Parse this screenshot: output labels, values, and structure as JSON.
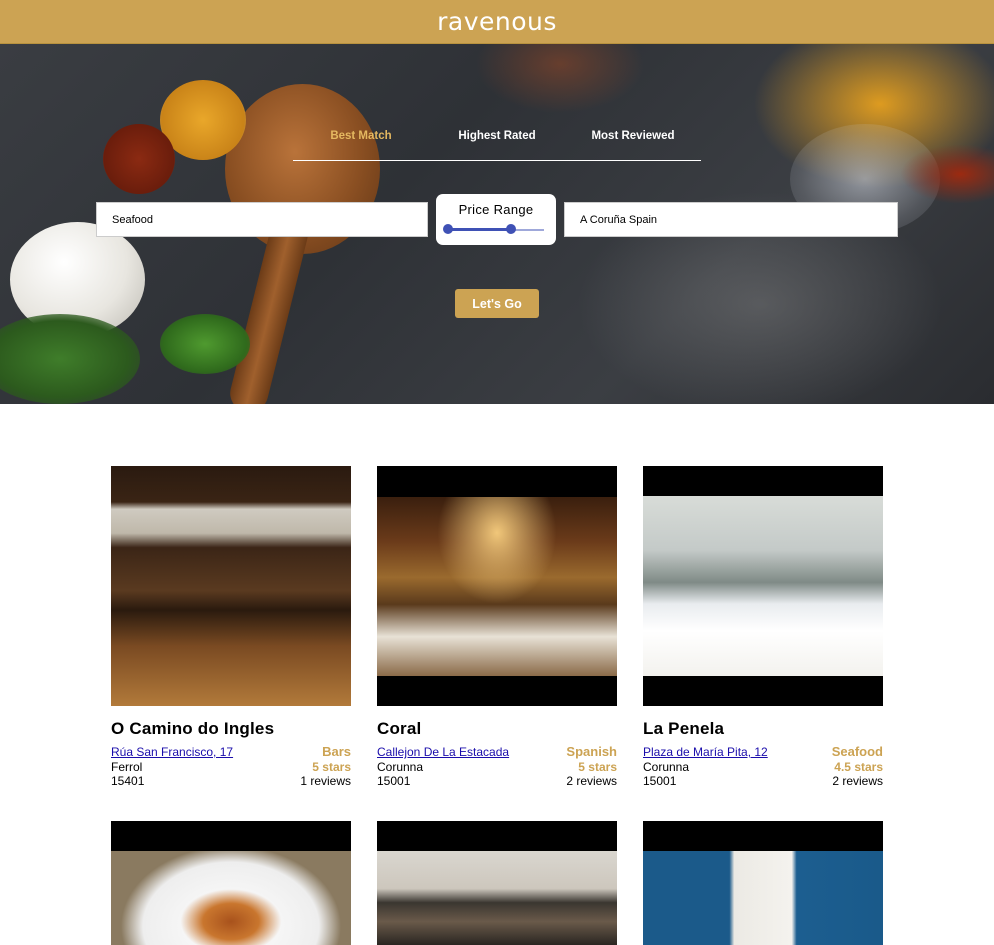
{
  "app": {
    "brand": "ravenous"
  },
  "colors": {
    "accent": "#cca353",
    "link": "#1a0dab",
    "slider": "#3f51b5"
  },
  "sort_options": [
    "Best Match",
    "Highest Rated",
    "Most Reviewed"
  ],
  "sort_active": "Best Match",
  "search": {
    "term": "Seafood",
    "location": "A Coruña Spain",
    "price_label": "Price Range",
    "price_range_fraction": [
      0.0,
      0.66
    ],
    "submit_label": "Let's Go"
  },
  "businesses": [
    {
      "name": "O Camino do Ingles",
      "address": "Rúa San Francisco, 17",
      "city": "Ferrol",
      "zip": "15401",
      "category": "Bars",
      "rating": "5 stars",
      "reviews": "1 reviews"
    },
    {
      "name": "Coral",
      "address": "Callejon De La Estacada",
      "city": "Corunna",
      "zip": "15001",
      "category": "Spanish",
      "rating": "5 stars",
      "reviews": "2 reviews"
    },
    {
      "name": "La Penela",
      "address": "Plaza de María Pita, 12",
      "city": "Corunna",
      "zip": "15001",
      "category": "Seafood",
      "rating": "4.5 stars",
      "reviews": "2 reviews"
    },
    {
      "name": "",
      "address": "",
      "city": "",
      "zip": "",
      "category": "",
      "rating": "",
      "reviews": ""
    },
    {
      "name": "",
      "address": "",
      "city": "",
      "zip": "",
      "category": "",
      "rating": "",
      "reviews": ""
    },
    {
      "name": "",
      "address": "",
      "city": "",
      "zip": "",
      "category": "",
      "rating": "",
      "reviews": ""
    }
  ]
}
